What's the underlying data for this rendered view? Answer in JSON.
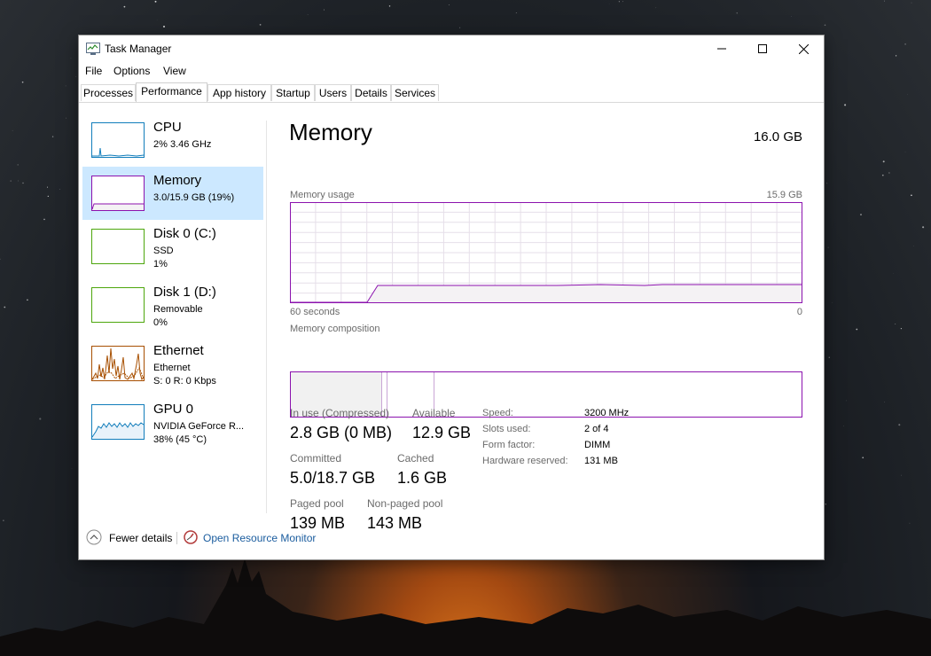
{
  "window": {
    "title": "Task Manager"
  },
  "menu": [
    "File",
    "Options",
    "View"
  ],
  "tabs": [
    "Processes",
    "Performance",
    "App history",
    "Startup",
    "Users",
    "Details",
    "Services"
  ],
  "active_tab": "Performance",
  "sidebar": [
    {
      "title": "CPU",
      "line1": "2%  3.46 GHz",
      "line2": "",
      "color": "#117dbb",
      "selected": false
    },
    {
      "title": "Memory",
      "line1": "3.0/15.9 GB (19%)",
      "line2": "",
      "color": "#8b12ae",
      "selected": true
    },
    {
      "title": "Disk 0 (C:)",
      "line1": "SSD",
      "line2": "1%",
      "color": "#4da60c",
      "selected": false
    },
    {
      "title": "Disk 1 (D:)",
      "line1": "Removable",
      "line2": "0%",
      "color": "#4da60c",
      "selected": false
    },
    {
      "title": "Ethernet",
      "line1": "Ethernet",
      "line2": "S: 0  R: 0 Kbps",
      "color": "#a74f01",
      "selected": false
    },
    {
      "title": "GPU 0",
      "line1": "NVIDIA GeForce R...",
      "line2": "38%  (45 °C)",
      "color": "#117dbb",
      "selected": false
    }
  ],
  "main": {
    "title": "Memory",
    "total": "16.0 GB",
    "usage_label": "Memory usage",
    "usage_max": "15.9 GB",
    "time_left": "60 seconds",
    "time_right": "0",
    "composition_label": "Memory composition",
    "usage_fraction": 0.19
  },
  "stats": {
    "in_use_label": "In use (Compressed)",
    "in_use_value": "2.8 GB (0 MB)",
    "available_label": "Available",
    "available_value": "12.9 GB",
    "committed_label": "Committed",
    "committed_value": "5.0/18.7 GB",
    "cached_label": "Cached",
    "cached_value": "1.6 GB",
    "paged_label": "Paged pool",
    "paged_value": "139 MB",
    "nonpaged_label": "Non-paged pool",
    "nonpaged_value": "143 MB"
  },
  "specs": {
    "speed_label": "Speed:",
    "speed_value": "3200 MHz",
    "slots_label": "Slots used:",
    "slots_value": "2 of 4",
    "form_label": "Form factor:",
    "form_value": "DIMM",
    "reserved_label": "Hardware reserved:",
    "reserved_value": "131 MB"
  },
  "footer": {
    "fewer_details": "Fewer details",
    "open_monitor": "Open Resource Monitor"
  },
  "colors": {
    "memory": "#8b12ae",
    "memory_fill": "#f4f2f4",
    "selection": "#cce8ff",
    "link": "#1a5c9e"
  }
}
